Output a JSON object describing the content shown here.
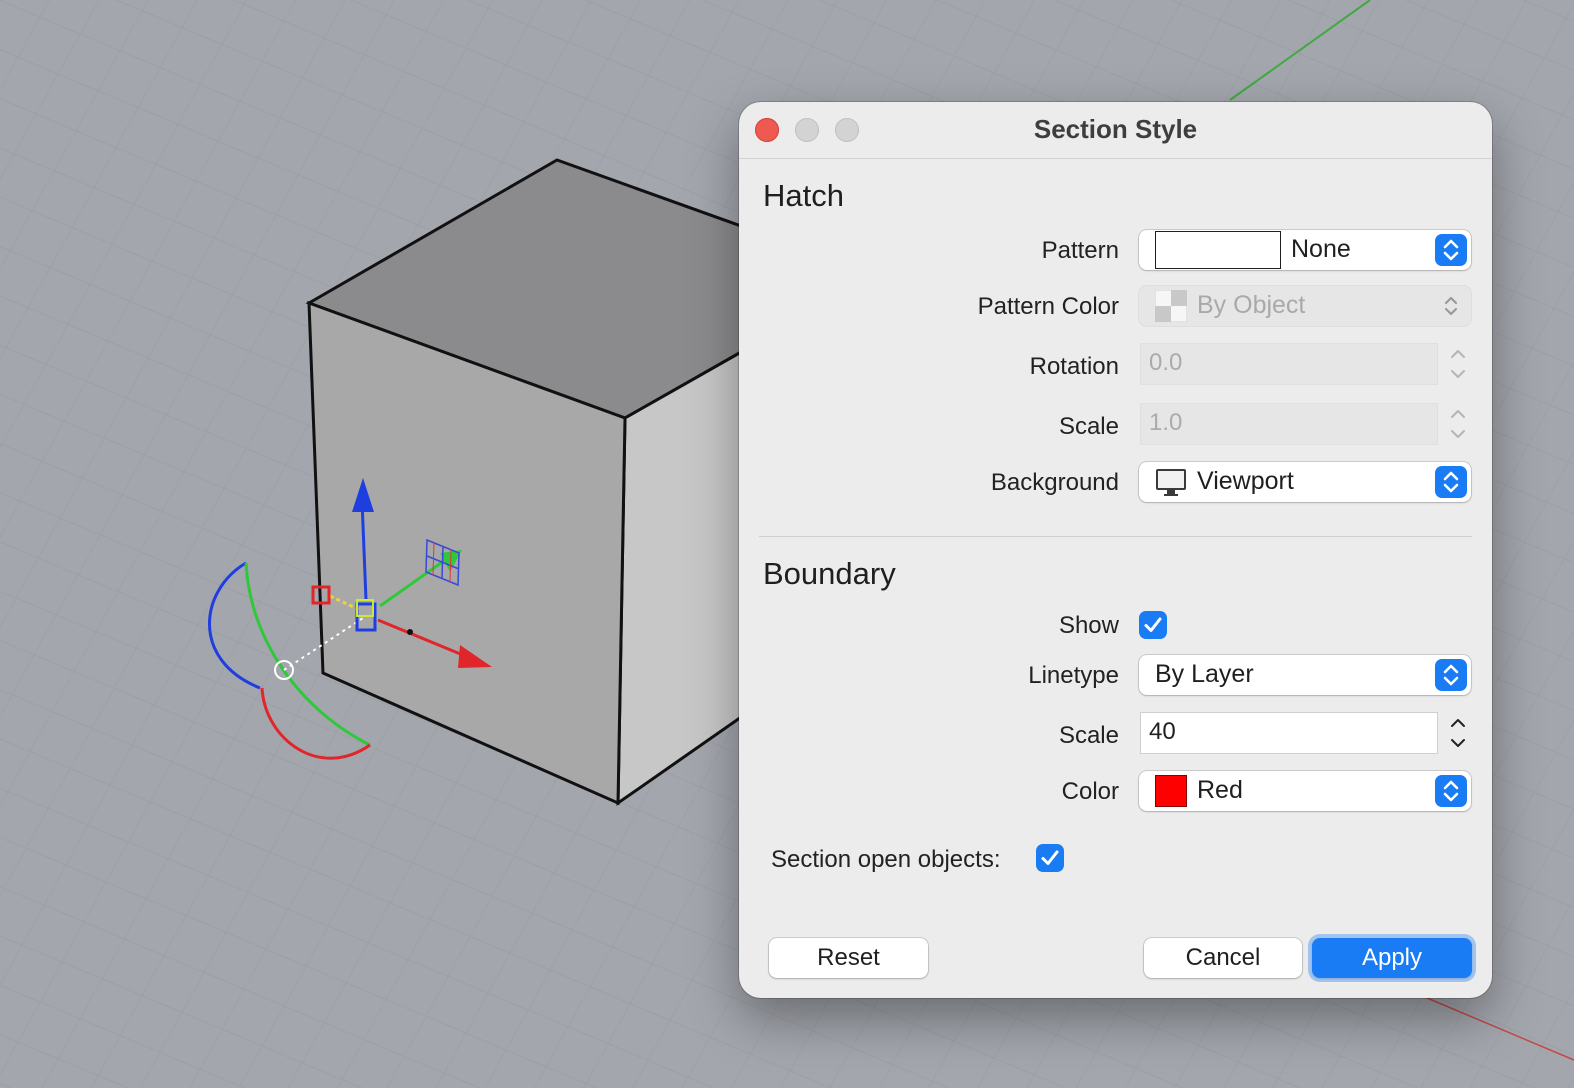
{
  "window": {
    "title": "Section Style"
  },
  "hatch": {
    "heading": "Hatch",
    "pattern": {
      "label": "Pattern",
      "value": "None"
    },
    "pattern_color": {
      "label": "Pattern Color",
      "value": "By Object"
    },
    "rotation": {
      "label": "Rotation",
      "value": "0.0"
    },
    "scale": {
      "label": "Scale",
      "value": "1.0"
    },
    "background": {
      "label": "Background",
      "value": "Viewport"
    }
  },
  "boundary": {
    "heading": "Boundary",
    "show": {
      "label": "Show",
      "checked": true
    },
    "linetype": {
      "label": "Linetype",
      "value": "By Layer"
    },
    "scale": {
      "label": "Scale",
      "value": "40"
    },
    "color": {
      "label": "Color",
      "value": "Red",
      "swatch": "#ff0000"
    }
  },
  "section_open_objects": {
    "label": "Section open objects:",
    "checked": true
  },
  "buttons": {
    "reset": "Reset",
    "cancel": "Cancel",
    "apply": "Apply"
  },
  "colors": {
    "accent": "#1a7cf5",
    "close": "#ee5a52",
    "viewport": "#a3a6ad"
  }
}
